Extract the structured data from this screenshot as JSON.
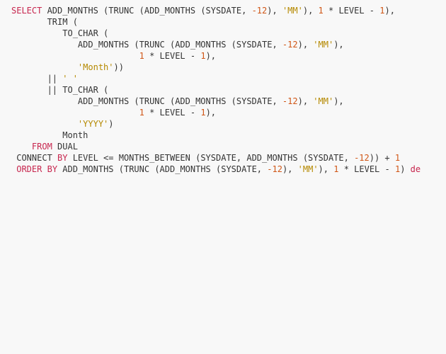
{
  "code": {
    "tokens": [
      {
        "t": "SELECT",
        "c": "kw"
      },
      {
        "t": " ADD_MONTHS (TRUNC (ADD_MONTHS (SYSDATE, ",
        "c": "fn"
      },
      {
        "t": "-12",
        "c": "num"
      },
      {
        "t": "), ",
        "c": "fn"
      },
      {
        "t": "'MM'",
        "c": "str"
      },
      {
        "t": "), ",
        "c": "fn"
      },
      {
        "t": "1",
        "c": "num"
      },
      {
        "t": " * LEVEL - ",
        "c": "fn"
      },
      {
        "t": "1",
        "c": "num"
      },
      {
        "t": "),",
        "c": "fn"
      },
      {
        "t": "\n",
        "c": ""
      },
      {
        "t": "       TRIM (",
        "c": "fn"
      },
      {
        "t": "\n",
        "c": ""
      },
      {
        "t": "          TO_CHAR (",
        "c": "fn"
      },
      {
        "t": "\n",
        "c": ""
      },
      {
        "t": "             ADD_MONTHS (TRUNC (ADD_MONTHS (SYSDATE, ",
        "c": "fn"
      },
      {
        "t": "-12",
        "c": "num"
      },
      {
        "t": "), ",
        "c": "fn"
      },
      {
        "t": "'MM'",
        "c": "str"
      },
      {
        "t": "),",
        "c": "fn"
      },
      {
        "t": "\n",
        "c": ""
      },
      {
        "t": "                         ",
        "c": "fn"
      },
      {
        "t": "1",
        "c": "num"
      },
      {
        "t": " * LEVEL - ",
        "c": "fn"
      },
      {
        "t": "1",
        "c": "num"
      },
      {
        "t": "),",
        "c": "fn"
      },
      {
        "t": "\n",
        "c": ""
      },
      {
        "t": "             ",
        "c": "fn"
      },
      {
        "t": "'Month'",
        "c": "str"
      },
      {
        "t": "))",
        "c": "fn"
      },
      {
        "t": "\n",
        "c": ""
      },
      {
        "t": "       || ",
        "c": "fn"
      },
      {
        "t": "' '",
        "c": "str"
      },
      {
        "t": "\n",
        "c": ""
      },
      {
        "t": "       || TO_CHAR (",
        "c": "fn"
      },
      {
        "t": "\n",
        "c": ""
      },
      {
        "t": "             ADD_MONTHS (TRUNC (ADD_MONTHS (SYSDATE, ",
        "c": "fn"
      },
      {
        "t": "-12",
        "c": "num"
      },
      {
        "t": "), ",
        "c": "fn"
      },
      {
        "t": "'MM'",
        "c": "str"
      },
      {
        "t": "),",
        "c": "fn"
      },
      {
        "t": "\n",
        "c": ""
      },
      {
        "t": "                         ",
        "c": "fn"
      },
      {
        "t": "1",
        "c": "num"
      },
      {
        "t": " * LEVEL - ",
        "c": "fn"
      },
      {
        "t": "1",
        "c": "num"
      },
      {
        "t": "),",
        "c": "fn"
      },
      {
        "t": "\n",
        "c": ""
      },
      {
        "t": "             ",
        "c": "fn"
      },
      {
        "t": "'YYYY'",
        "c": "str"
      },
      {
        "t": ")",
        "c": "fn"
      },
      {
        "t": "\n",
        "c": ""
      },
      {
        "t": "          Month",
        "c": "fn"
      },
      {
        "t": "\n",
        "c": ""
      },
      {
        "t": "    ",
        "c": "fn"
      },
      {
        "t": "FROM",
        "c": "kw"
      },
      {
        "t": " DUAL",
        "c": "fn"
      },
      {
        "t": "\n",
        "c": ""
      },
      {
        "t": " CONNECT ",
        "c": "fn"
      },
      {
        "t": "BY",
        "c": "kw"
      },
      {
        "t": " LEVEL <= MONTHS_BETWEEN (SYSDATE, ADD_MONTHS (SYSDATE, ",
        "c": "fn"
      },
      {
        "t": "-12",
        "c": "num"
      },
      {
        "t": ")) + ",
        "c": "fn"
      },
      {
        "t": "1",
        "c": "num"
      },
      {
        "t": "\n",
        "c": ""
      },
      {
        "t": " ",
        "c": "fn"
      },
      {
        "t": "ORDER",
        "c": "kw"
      },
      {
        "t": " ",
        "c": "fn"
      },
      {
        "t": "BY",
        "c": "kw"
      },
      {
        "t": " ADD_MONTHS (TRUNC (ADD_MONTHS (SYSDATE, ",
        "c": "fn"
      },
      {
        "t": "-12",
        "c": "num"
      },
      {
        "t": "), ",
        "c": "fn"
      },
      {
        "t": "'MM'",
        "c": "str"
      },
      {
        "t": "), ",
        "c": "fn"
      },
      {
        "t": "1",
        "c": "num"
      },
      {
        "t": " * LEVEL - ",
        "c": "fn"
      },
      {
        "t": "1",
        "c": "num"
      },
      {
        "t": ") ",
        "c": "fn"
      },
      {
        "t": "de",
        "c": "kw"
      }
    ]
  }
}
